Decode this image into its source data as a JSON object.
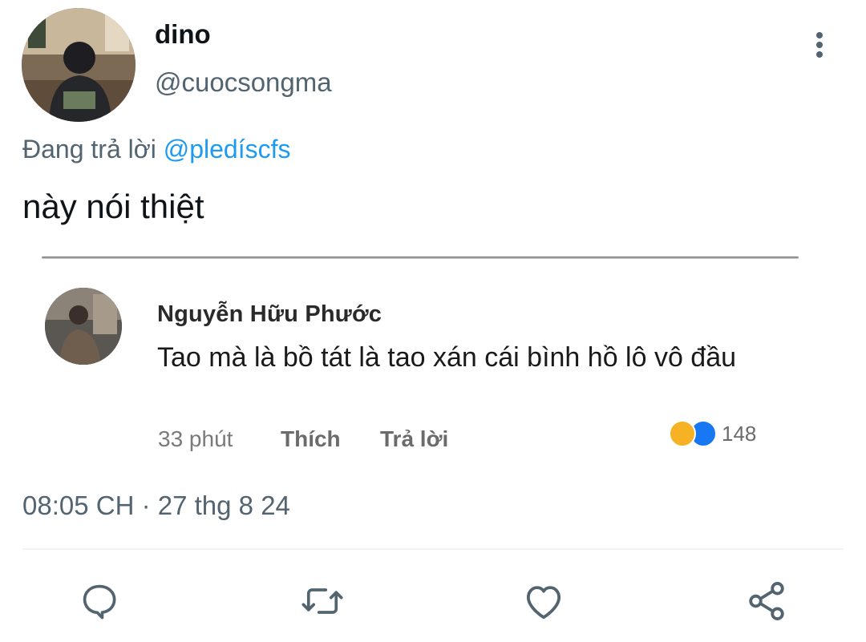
{
  "tweet": {
    "author": {
      "display_name": "dino",
      "handle": "@cuocsongma"
    },
    "reply_context": {
      "prefix": "Đang trả lời",
      "mention": "@pledíscfs"
    },
    "text": "này nói thiệt",
    "timestamp": "08:05 CH",
    "separator": "·",
    "date": "27 thg 8 24"
  },
  "embedded_comment": {
    "author": "Nguyễn Hữu Phước",
    "text": "Tao mà là bồ tát là tao xán cái bình hồ lô vô đầu",
    "time": "33 phút",
    "like_label": "Thích",
    "reply_label": "Trả lời",
    "reaction_count": "148",
    "reactions": [
      "haha-icon",
      "like-icon"
    ]
  },
  "actions": [
    {
      "name": "reply-icon"
    },
    {
      "name": "retweet-icon"
    },
    {
      "name": "like-icon"
    },
    {
      "name": "share-icon"
    }
  ],
  "colors": {
    "text_primary": "#0f1419",
    "text_secondary": "#536471",
    "accent_blue": "#1d9bf0",
    "divider": "#eff3f4"
  }
}
